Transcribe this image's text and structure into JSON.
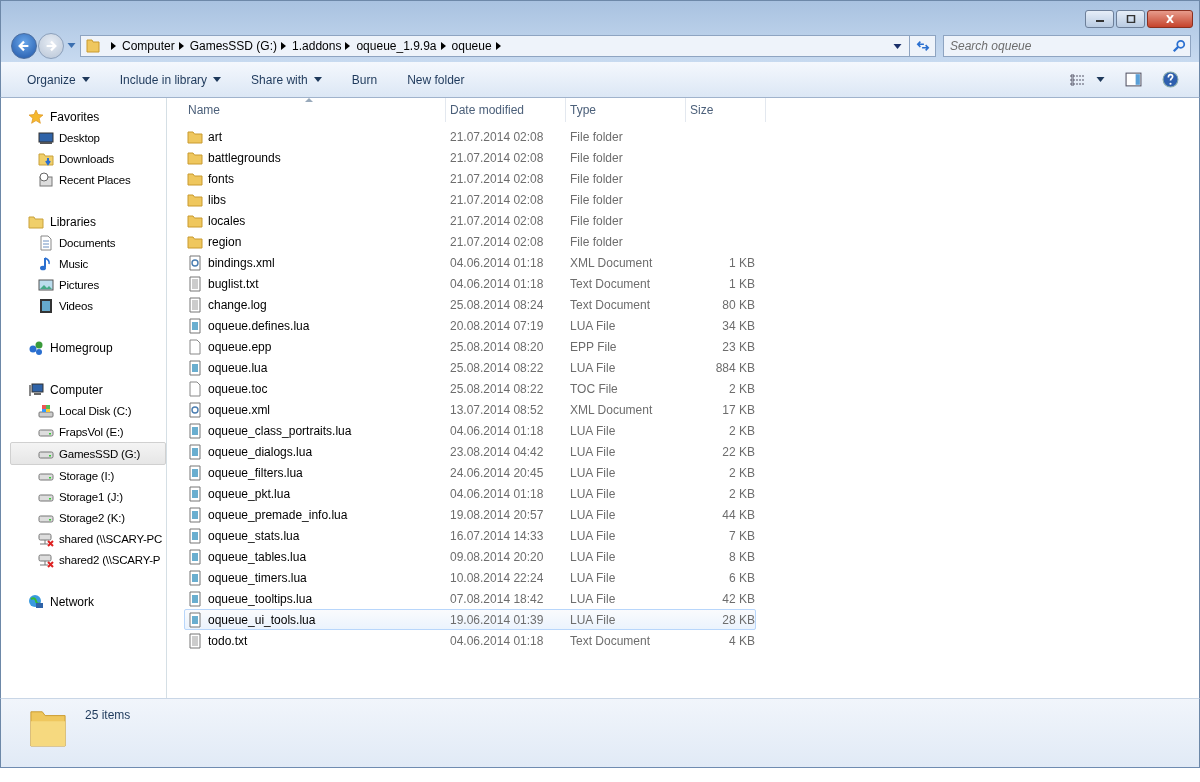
{
  "address": {
    "crumbs": [
      "Computer",
      "GamesSSD (G:)",
      "1.addons",
      "oqueue_1.9.9a",
      "oqueue"
    ]
  },
  "search": {
    "placeholder": "Search oqueue"
  },
  "toolbar": [
    {
      "label": "Organize",
      "dropdown": true
    },
    {
      "label": "Include in library",
      "dropdown": true
    },
    {
      "label": "Share with",
      "dropdown": true
    },
    {
      "label": "Burn",
      "dropdown": false
    },
    {
      "label": "New folder",
      "dropdown": false
    }
  ],
  "sidebar": [
    {
      "label": "Favorites",
      "kind": "star",
      "selected": false,
      "children": [
        {
          "label": "Desktop",
          "kind": "desktop",
          "selected": false
        },
        {
          "label": "Downloads",
          "kind": "downloads",
          "selected": false
        },
        {
          "label": "Recent Places",
          "kind": "recent",
          "selected": false
        }
      ]
    },
    {
      "label": "Libraries",
      "kind": "library",
      "selected": false,
      "children": [
        {
          "label": "Documents",
          "kind": "document",
          "selected": false
        },
        {
          "label": "Music",
          "kind": "music",
          "selected": false
        },
        {
          "label": "Pictures",
          "kind": "pictures",
          "selected": false
        },
        {
          "label": "Videos",
          "kind": "videos",
          "selected": false
        }
      ]
    },
    {
      "label": "Homegroup",
      "kind": "homegroup",
      "selected": false
    },
    {
      "label": "Computer",
      "kind": "computer",
      "selected": false,
      "children": [
        {
          "label": "Local Disk (C:)",
          "kind": "systemdisk",
          "selected": false
        },
        {
          "label": "FrapsVol (E:)",
          "kind": "drive",
          "selected": false
        },
        {
          "label": "GamesSSD (G:)",
          "kind": "drive",
          "selected": true
        },
        {
          "label": "Storage (I:)",
          "kind": "drive",
          "selected": false
        },
        {
          "label": "Storage1 (J:)",
          "kind": "drive",
          "selected": false
        },
        {
          "label": "Storage2 (K:)",
          "kind": "drive",
          "selected": false
        },
        {
          "label": "shared (\\\\SCARY-PC",
          "kind": "netdrive",
          "selected": false
        },
        {
          "label": "shared2 (\\\\SCARY-P",
          "kind": "netdrive",
          "selected": false
        }
      ]
    },
    {
      "label": "Network",
      "kind": "network",
      "selected": false
    }
  ],
  "table": {
    "columns": [
      "Name",
      "Date modified",
      "Type",
      "Size"
    ],
    "rows": [
      {
        "name": "art",
        "date": "21.07.2014 02:08",
        "type": "File folder",
        "size": "",
        "kind": "folder",
        "hovered": false
      },
      {
        "name": "battlegrounds",
        "date": "21.07.2014 02:08",
        "type": "File folder",
        "size": "",
        "kind": "folder",
        "hovered": false
      },
      {
        "name": "fonts",
        "date": "21.07.2014 02:08",
        "type": "File folder",
        "size": "",
        "kind": "folder",
        "hovered": false
      },
      {
        "name": "libs",
        "date": "21.07.2014 02:08",
        "type": "File folder",
        "size": "",
        "kind": "folder",
        "hovered": false
      },
      {
        "name": "locales",
        "date": "21.07.2014 02:08",
        "type": "File folder",
        "size": "",
        "kind": "folder",
        "hovered": false
      },
      {
        "name": "region",
        "date": "21.07.2014 02:08",
        "type": "File folder",
        "size": "",
        "kind": "folder",
        "hovered": false
      },
      {
        "name": "bindings.xml",
        "date": "04.06.2014 01:18",
        "type": "XML Document",
        "size": "1 KB",
        "kind": "xml",
        "hovered": false
      },
      {
        "name": "buglist.txt",
        "date": "04.06.2014 01:18",
        "type": "Text Document",
        "size": "1 KB",
        "kind": "text",
        "hovered": false
      },
      {
        "name": "change.log",
        "date": "25.08.2014 08:24",
        "type": "Text Document",
        "size": "80 KB",
        "kind": "text",
        "hovered": false
      },
      {
        "name": "oqueue.defines.lua",
        "date": "20.08.2014 07:19",
        "type": "LUA File",
        "size": "34 KB",
        "kind": "script",
        "hovered": false
      },
      {
        "name": "oqueue.epp",
        "date": "25.08.2014 08:20",
        "type": "EPP File",
        "size": "23 KB",
        "kind": "blank",
        "hovered": false
      },
      {
        "name": "oqueue.lua",
        "date": "25.08.2014 08:22",
        "type": "LUA File",
        "size": "884 KB",
        "kind": "script",
        "hovered": false
      },
      {
        "name": "oqueue.toc",
        "date": "25.08.2014 08:22",
        "type": "TOC File",
        "size": "2 KB",
        "kind": "blank",
        "hovered": false
      },
      {
        "name": "oqueue.xml",
        "date": "13.07.2014 08:52",
        "type": "XML Document",
        "size": "17 KB",
        "kind": "xml",
        "hovered": false
      },
      {
        "name": "oqueue_class_portraits.lua",
        "date": "04.06.2014 01:18",
        "type": "LUA File",
        "size": "2 KB",
        "kind": "script",
        "hovered": false
      },
      {
        "name": "oqueue_dialogs.lua",
        "date": "23.08.2014 04:42",
        "type": "LUA File",
        "size": "22 KB",
        "kind": "script",
        "hovered": false
      },
      {
        "name": "oqueue_filters.lua",
        "date": "24.06.2014 20:45",
        "type": "LUA File",
        "size": "2 KB",
        "kind": "script",
        "hovered": false
      },
      {
        "name": "oqueue_pkt.lua",
        "date": "04.06.2014 01:18",
        "type": "LUA File",
        "size": "2 KB",
        "kind": "script",
        "hovered": false
      },
      {
        "name": "oqueue_premade_info.lua",
        "date": "19.08.2014 20:57",
        "type": "LUA File",
        "size": "44 KB",
        "kind": "script",
        "hovered": false
      },
      {
        "name": "oqueue_stats.lua",
        "date": "16.07.2014 14:33",
        "type": "LUA File",
        "size": "7 KB",
        "kind": "script",
        "hovered": false
      },
      {
        "name": "oqueue_tables.lua",
        "date": "09.08.2014 20:20",
        "type": "LUA File",
        "size": "8 KB",
        "kind": "script",
        "hovered": false
      },
      {
        "name": "oqueue_timers.lua",
        "date": "10.08.2014 22:24",
        "type": "LUA File",
        "size": "6 KB",
        "kind": "script",
        "hovered": false
      },
      {
        "name": "oqueue_tooltips.lua",
        "date": "07.08.2014 18:42",
        "type": "LUA File",
        "size": "42 KB",
        "kind": "script",
        "hovered": false
      },
      {
        "name": "oqueue_ui_tools.lua",
        "date": "19.06.2014 01:39",
        "type": "LUA File",
        "size": "28 KB",
        "kind": "script",
        "hovered": true
      },
      {
        "name": "todo.txt",
        "date": "04.06.2014 01:18",
        "type": "Text Document",
        "size": "4 KB",
        "kind": "text",
        "hovered": false
      }
    ]
  },
  "status_bar": {
    "count": "25 items"
  }
}
